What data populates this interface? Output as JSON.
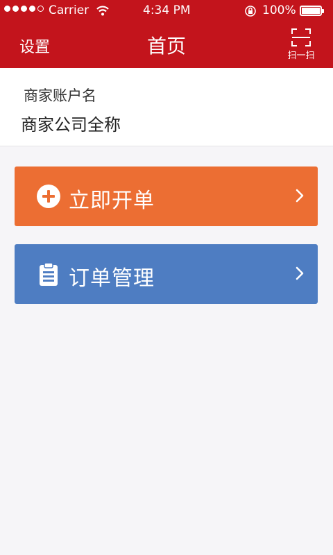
{
  "status_bar": {
    "carrier": "Carrier",
    "time": "4:34 PM",
    "battery": "100%"
  },
  "nav": {
    "left_label": "设置",
    "title": "首页",
    "scan_label": "扫一扫"
  },
  "account": {
    "account_name": "商家账户名",
    "company_name": "商家公司全称"
  },
  "actions": [
    {
      "label": "立即开单",
      "color": "#ec6e33",
      "icon": "plus-circle-icon"
    },
    {
      "label": "订单管理",
      "color": "#4e7dc2",
      "icon": "clipboard-icon"
    }
  ],
  "colors": {
    "header": "#c3141c",
    "background": "#f6f5f8"
  }
}
